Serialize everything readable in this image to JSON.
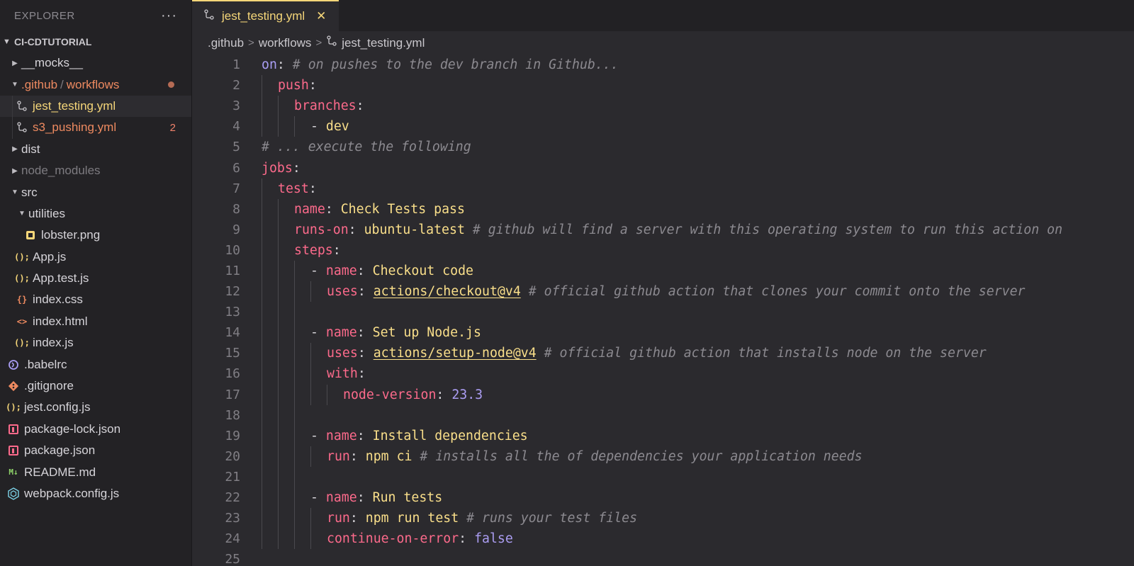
{
  "sidebar": {
    "title": "EXPLORER",
    "more_label": "···",
    "section": "CI-CDTUTORIAL",
    "items": [
      {
        "label": "__mocks__"
      },
      {
        "label_a": ".github",
        "label_sep": "/",
        "label_b": "workflows"
      },
      {
        "label": "jest_testing.yml"
      },
      {
        "label": "s3_pushing.yml",
        "badge": "2"
      },
      {
        "label": "dist"
      },
      {
        "label": "node_modules"
      },
      {
        "label": "src"
      },
      {
        "label": "utilities"
      },
      {
        "label": "lobster.png"
      },
      {
        "label": "App.js"
      },
      {
        "label": "App.test.js"
      },
      {
        "label": "index.css"
      },
      {
        "label": "index.html"
      },
      {
        "label": "index.js"
      },
      {
        "label": ".babelrc"
      },
      {
        "label": ".gitignore"
      },
      {
        "label": "jest.config.js"
      },
      {
        "label": "package-lock.json"
      },
      {
        "label": "package.json"
      },
      {
        "label": "README.md"
      },
      {
        "label": "webpack.config.js"
      }
    ]
  },
  "tab": {
    "label": "jest_testing.yml",
    "close": "✕"
  },
  "breadcrumb": {
    "part1": ".github",
    "part2": "workflows",
    "part3": "jest_testing.yml",
    "sep": ">"
  },
  "code": {
    "line_numbers": [
      "1",
      "2",
      "3",
      "4",
      "5",
      "6",
      "7",
      "8",
      "9",
      "10",
      "11",
      "12",
      "13",
      "14",
      "15",
      "16",
      "17",
      "18",
      "19",
      "20",
      "21",
      "22",
      "23",
      "24",
      "25"
    ],
    "l1_key": "on",
    "l1_colon": ":",
    "l1_comment": " # on pushes to the dev branch in Github...",
    "l2_key": "push",
    "l2_colon": ":",
    "l3_key": "branches",
    "l3_colon": ":",
    "l4_dash": "- ",
    "l4_val": "dev",
    "l5_comment": "# ... execute the following",
    "l6_key": "jobs",
    "l6_colon": ":",
    "l7_key": "test",
    "l7_colon": ":",
    "l8_key": "name",
    "l8_colon": ": ",
    "l8_val": "Check Tests pass",
    "l9_key": "runs-on",
    "l9_colon": ": ",
    "l9_val": "ubuntu-latest",
    "l9_comment": " # github will find a server with this operating system to run this action on",
    "l10_key": "steps",
    "l10_colon": ":",
    "l11_dash": "- ",
    "l11_key": "name",
    "l11_colon": ": ",
    "l11_val": "Checkout code",
    "l12_key": "uses",
    "l12_colon": ": ",
    "l12_val": "actions/checkout@v4",
    "l12_comment": " # official github action that clones your commit onto the server",
    "l14_dash": "- ",
    "l14_key": "name",
    "l14_colon": ": ",
    "l14_val": "Set up Node.js",
    "l15_key": "uses",
    "l15_colon": ": ",
    "l15_val": "actions/setup-node@v4",
    "l15_comment": " # official github action that installs node on the server",
    "l16_key": "with",
    "l16_colon": ":",
    "l17_key": "node-version",
    "l17_colon": ": ",
    "l17_val": "23.3",
    "l19_dash": "- ",
    "l19_key": "name",
    "l19_colon": ": ",
    "l19_val": "Install dependencies",
    "l20_key": "run",
    "l20_colon": ": ",
    "l20_val": "npm ci",
    "l20_comment": " # installs all the of dependencies your application needs",
    "l22_dash": "- ",
    "l22_key": "name",
    "l22_colon": ": ",
    "l22_val": "Run tests",
    "l23_key": "run",
    "l23_colon": ": ",
    "l23_val": "npm run test",
    "l23_comment": " # runs your test files",
    "l24_key": "continue-on-error",
    "l24_colon": ": ",
    "l24_val": "false"
  },
  "colors": {
    "accent": "#f5d679",
    "modified": "#ee8a60",
    "key": "#fc6a8b",
    "string": "#fadf8a",
    "number": "#ab9df2",
    "comment": "#8c8a90"
  },
  "icons": [
    "chevron-down-icon",
    "chevron-right-icon",
    "yaml-file-icon",
    "image-file-icon",
    "js-file-icon",
    "css-file-icon",
    "html-file-icon",
    "babel-icon",
    "git-icon",
    "json-file-icon",
    "markdown-icon",
    "webpack-icon",
    "close-icon"
  ]
}
